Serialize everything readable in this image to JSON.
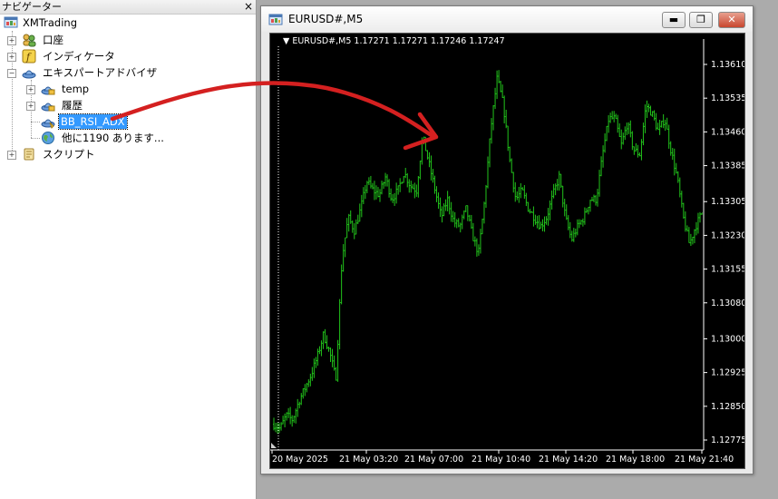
{
  "navigator": {
    "title": "ナビゲーター",
    "close_glyph": "×",
    "root_label": "XMTrading",
    "items": {
      "account": "口座",
      "indicators": "インディケータ",
      "expert_advisors": "エキスパートアドバイザ",
      "temp": "temp",
      "history": "履歴",
      "bb_rsi_adx": "BB_RSI_ADX",
      "more": "他に1190 あります...",
      "scripts": "スクリプト"
    }
  },
  "chart_window": {
    "title": "EURUSD#,M5",
    "min_glyph": "▬",
    "restore_glyph": "❐",
    "close_glyph": "✕",
    "info_line": "▼ EURUSD#,M5  1.17271 1.17271 1.17246 1.17247"
  },
  "colors": {
    "bar": "#22c41b",
    "arrow": "#d42020",
    "selection": "#3399ff"
  },
  "chart_data": {
    "type": "bar",
    "symbol": "EURUSD#",
    "timeframe": "M5",
    "ohlc_header": [
      "1.17271",
      "1.17271",
      "1.17246",
      "1.17247"
    ],
    "y_ticks": [
      "1.13610",
      "1.13535",
      "1.13460",
      "1.13385",
      "1.13305",
      "1.13230",
      "1.13155",
      "1.13080",
      "1.13000",
      "1.12925",
      "1.12850",
      "1.12775"
    ],
    "x_ticks": [
      "20 May 2025",
      "21 May 03:20",
      "21 May 07:00",
      "21 May 10:40",
      "21 May 14:20",
      "21 May 18:00",
      "21 May 21:40"
    ],
    "ylim": [
      1.1274,
      1.1365
    ],
    "series_profile_close": [
      1.1281,
      1.128,
      1.1283,
      1.1282,
      1.1286,
      1.1289,
      1.1292,
      1.1296,
      1.1301,
      1.1297,
      1.1291,
      1.1318,
      1.1327,
      1.1324,
      1.1329,
      1.1335,
      1.1333,
      1.1332,
      1.1336,
      1.1331,
      1.1333,
      1.1337,
      1.1334,
      1.1333,
      1.1345,
      1.1339,
      1.1333,
      1.1327,
      1.1331,
      1.1326,
      1.1325,
      1.1329,
      1.1323,
      1.1319,
      1.1331,
      1.1347,
      1.1358,
      1.1352,
      1.134,
      1.1331,
      1.1333,
      1.1329,
      1.1327,
      1.1325,
      1.1327,
      1.1332,
      1.1336,
      1.1327,
      1.1322,
      1.1325,
      1.1327,
      1.1331,
      1.1331,
      1.1341,
      1.1349,
      1.1349,
      1.1343,
      1.1348,
      1.1342,
      1.1341,
      1.1352,
      1.135,
      1.1346,
      1.1349,
      1.1342,
      1.1336,
      1.1327,
      1.1321,
      1.1325,
      1.1328
    ]
  }
}
